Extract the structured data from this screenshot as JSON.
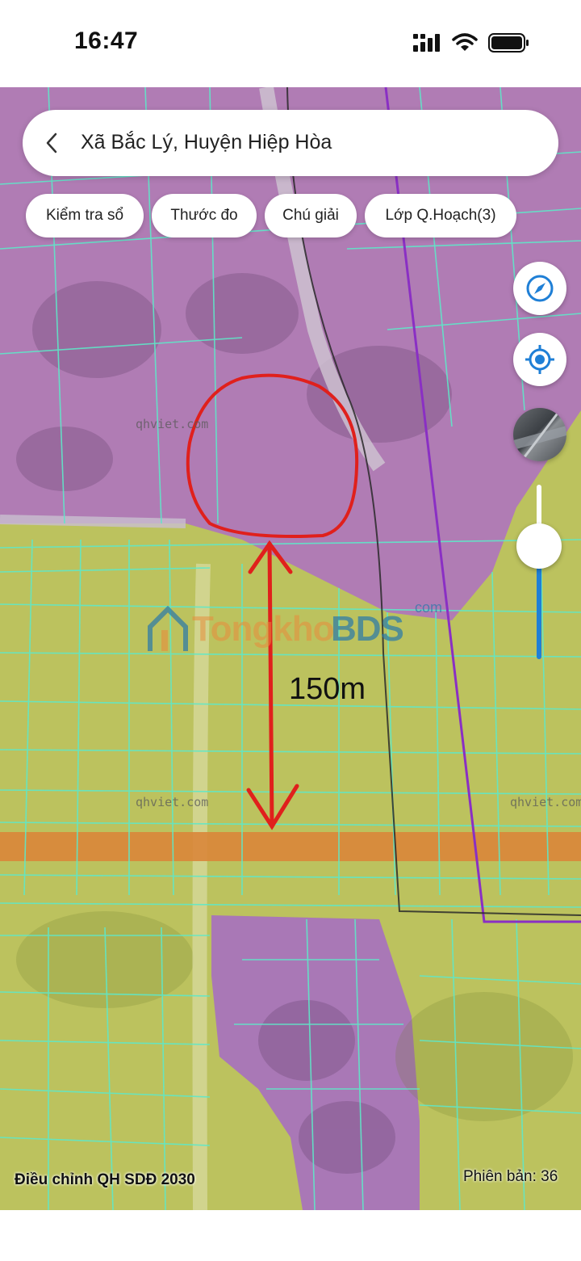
{
  "status_bar": {
    "time": "16:47",
    "signal_icon": "cellular-signal-icon",
    "wifi_icon": "wifi-icon",
    "battery_icon": "battery-icon"
  },
  "search": {
    "back_icon": "chevron-left-icon",
    "location_text": "Xã Bắc Lý, Huyện Hiệp Hòa"
  },
  "toolbar": {
    "chips": [
      {
        "label": "Kiểm tra sổ"
      },
      {
        "label": "Thước đo"
      },
      {
        "label": "Chú giải"
      },
      {
        "label": "Lớp Q.Hoạch(3)"
      }
    ]
  },
  "map_controls": {
    "compass_icon": "compass-icon",
    "locate_icon": "locate-crosshair-icon",
    "layer_icon": "satellite-layer-icon",
    "opacity_level": 0.36
  },
  "map": {
    "annotation_distance": "150m",
    "watermarks": [
      "qhviet.com",
      "qhviet.com",
      "qhviet.com"
    ],
    "brand_watermark": {
      "part1": "Tongkho",
      "part2": "BDS",
      "suffix": "com"
    },
    "plan_label": "Điều chỉnh QH SDĐ 2030",
    "version_label": "Phiên bản: 36",
    "colors": {
      "residential": "#b47ab4",
      "agricultural": "#c8c85a",
      "road_band": "#d9863a",
      "parcel_lines": "#5fe8c8",
      "boundary": "#8a2fc4",
      "annotation": "#e0201c"
    }
  }
}
